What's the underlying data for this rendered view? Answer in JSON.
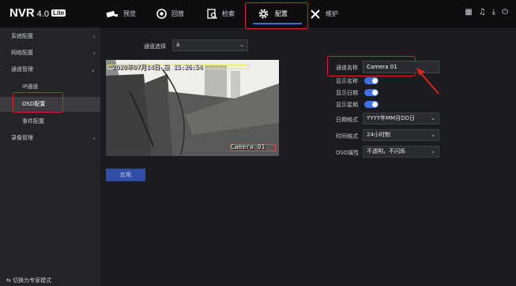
{
  "brand": {
    "name": "NVR",
    "version": "4.0",
    "edition": "Lite"
  },
  "nav": [
    {
      "label": "预览",
      "icon": "camera-icon"
    },
    {
      "label": "回放",
      "icon": "playback-icon"
    },
    {
      "label": "检索",
      "icon": "search-icon"
    },
    {
      "label": "配置",
      "icon": "gear-icon"
    },
    {
      "label": "维护",
      "icon": "tools-icon"
    }
  ],
  "sidebar": {
    "items": [
      {
        "label": "系统配置"
      },
      {
        "label": "网络配置"
      },
      {
        "label": "通道管理"
      },
      {
        "label": "IP通道"
      },
      {
        "label": "OSD配置"
      },
      {
        "label": "事件配置"
      },
      {
        "label": "录像管理"
      }
    ],
    "expert_mode": "切换为专家模式"
  },
  "channel_select": {
    "label": "通道选择",
    "value": "á"
  },
  "video": {
    "osd_time": "2020年07月14日 星  15:26:54",
    "osd_name": "Camera 01"
  },
  "settings": {
    "channel_name": {
      "label": "通道名称",
      "value": "Camera 01"
    },
    "show_name": {
      "label": "显示名称",
      "on": true
    },
    "show_date": {
      "label": "显示日期",
      "on": true
    },
    "show_week": {
      "label": "显示星期",
      "on": true
    },
    "date_format": {
      "label": "日期格式",
      "value": "YYYY年MM月DD日"
    },
    "time_format": {
      "label": "时间格式",
      "value": "24小时制"
    },
    "osd_attr": {
      "label": "OSD属性",
      "value": "不透明，不闪烁"
    }
  },
  "apply_label": "应用",
  "colors": {
    "accent": "#3f6ee8",
    "highlight": "#e0211f",
    "apply": "#304ea6"
  }
}
